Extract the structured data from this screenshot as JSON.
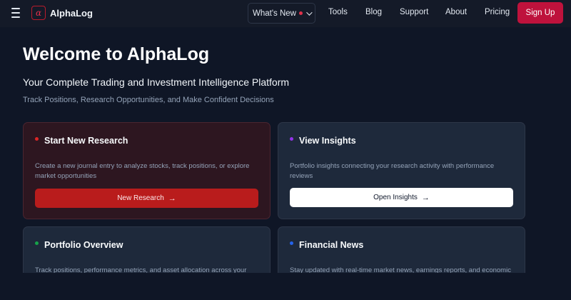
{
  "nav": {
    "logo_glyph": "α",
    "brand": "AlphaLog",
    "whats_new": "What's New",
    "links": [
      "Tools",
      "Blog",
      "Support",
      "About",
      "Pricing"
    ],
    "signup": "Sign Up"
  },
  "hero": {
    "title": "Welcome to AlphaLog",
    "subtitle": "Your Complete Trading and Investment Intelligence Platform",
    "tagline": "Track Positions, Research Opportunities, and Make Confident Decisions"
  },
  "cards": [
    {
      "title": "Start New Research",
      "dot_color": "#dc2626",
      "description": "Create a new journal entry to analyze stocks, track positions, or explore market opportunities",
      "button": "New Research"
    },
    {
      "title": "View Insights",
      "dot_color": "#9333ea",
      "description": "Portfolio insights connecting your research activity with performance reviews",
      "button": "Open Insights"
    },
    {
      "title": "Portfolio Overview",
      "dot_color": "#16a34a",
      "description": "Track positions, performance metrics, and asset allocation across your"
    },
    {
      "title": "Financial News",
      "dot_color": "#2563eb",
      "description": "Stay updated with real-time market news, earnings reports, and economic"
    }
  ],
  "colors": {
    "accent": "#be123c",
    "background": "#0f1626"
  }
}
